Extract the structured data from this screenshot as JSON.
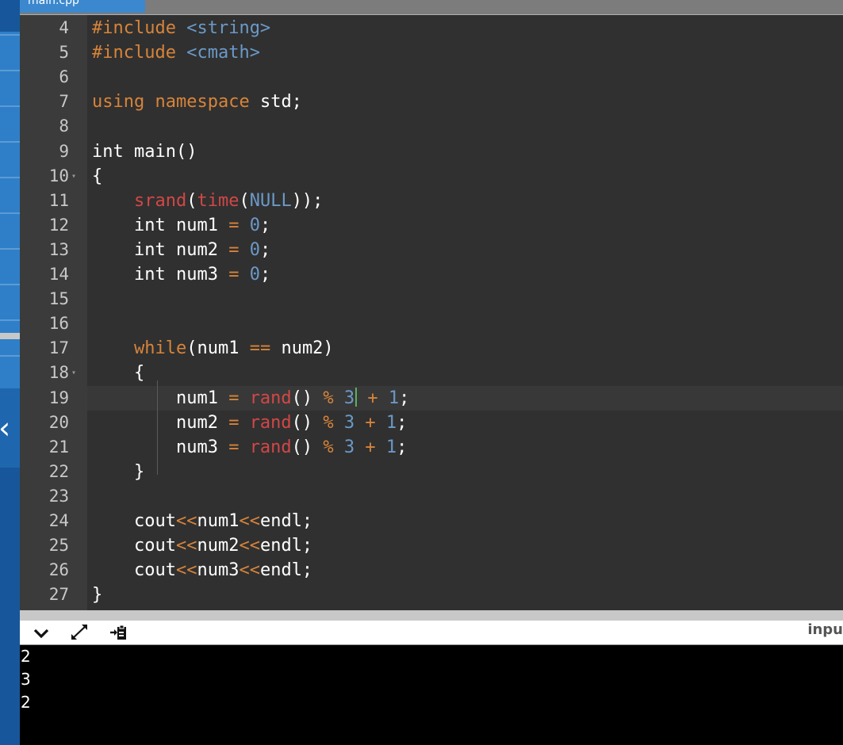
{
  "file_tab": {
    "label": "main.cpp"
  },
  "code_lines": [
    {
      "n": "4",
      "tokens": [
        [
          "kw",
          "#include"
        ],
        [
          "txt",
          " "
        ],
        [
          "str",
          "<string>"
        ]
      ]
    },
    {
      "n": "5",
      "tokens": [
        [
          "kw",
          "#include"
        ],
        [
          "txt",
          " "
        ],
        [
          "str",
          "<cmath>"
        ]
      ]
    },
    {
      "n": "6",
      "tokens": []
    },
    {
      "n": "7",
      "tokens": [
        [
          "kw",
          "using"
        ],
        [
          "txt",
          " "
        ],
        [
          "kw",
          "namespace"
        ],
        [
          "txt",
          " std;"
        ]
      ]
    },
    {
      "n": "8",
      "tokens": []
    },
    {
      "n": "9",
      "tokens": [
        [
          "txt",
          "int main()"
        ]
      ]
    },
    {
      "n": "10",
      "tokens": [
        [
          "txt",
          "{"
        ]
      ]
    },
    {
      "n": "11",
      "tokens": [
        [
          "txt",
          "    "
        ],
        [
          "fn",
          "srand"
        ],
        [
          "txt",
          "("
        ],
        [
          "fn",
          "time"
        ],
        [
          "txt",
          "("
        ],
        [
          "str",
          "NULL"
        ],
        [
          "txt",
          "));"
        ]
      ]
    },
    {
      "n": "12",
      "tokens": [
        [
          "txt",
          "    int num1 "
        ],
        [
          "op",
          "="
        ],
        [
          "txt",
          " "
        ],
        [
          "num",
          "0"
        ],
        [
          "txt",
          ";"
        ]
      ]
    },
    {
      "n": "13",
      "tokens": [
        [
          "txt",
          "    int num2 "
        ],
        [
          "op",
          "="
        ],
        [
          "txt",
          " "
        ],
        [
          "num",
          "0"
        ],
        [
          "txt",
          ";"
        ]
      ]
    },
    {
      "n": "14",
      "tokens": [
        [
          "txt",
          "    int num3 "
        ],
        [
          "op",
          "="
        ],
        [
          "txt",
          " "
        ],
        [
          "num",
          "0"
        ],
        [
          "txt",
          ";"
        ]
      ]
    },
    {
      "n": "15",
      "tokens": []
    },
    {
      "n": "16",
      "tokens": []
    },
    {
      "n": "17",
      "tokens": [
        [
          "txt",
          "    "
        ],
        [
          "kw",
          "while"
        ],
        [
          "txt",
          "(num1 "
        ],
        [
          "op",
          "=="
        ],
        [
          "txt",
          " num2)"
        ]
      ]
    },
    {
      "n": "18",
      "tokens": [
        [
          "txt",
          "    {"
        ]
      ]
    },
    {
      "n": "19",
      "tokens": [
        [
          "txt",
          "        num1 "
        ],
        [
          "op",
          "="
        ],
        [
          "txt",
          " "
        ],
        [
          "fn",
          "rand"
        ],
        [
          "txt",
          "() "
        ],
        [
          "op",
          "%"
        ],
        [
          "txt",
          " "
        ],
        [
          "num",
          "3"
        ],
        [
          "cursor",
          ""
        ],
        [
          "txt",
          " "
        ],
        [
          "op",
          "+"
        ],
        [
          "txt",
          " "
        ],
        [
          "num",
          "1"
        ],
        [
          "txt",
          ";"
        ]
      ]
    },
    {
      "n": "20",
      "tokens": [
        [
          "txt",
          "        num2 "
        ],
        [
          "op",
          "="
        ],
        [
          "txt",
          " "
        ],
        [
          "fn",
          "rand"
        ],
        [
          "txt",
          "() "
        ],
        [
          "op",
          "%"
        ],
        [
          "txt",
          " "
        ],
        [
          "num",
          "3"
        ],
        [
          "txt",
          " "
        ],
        [
          "op",
          "+"
        ],
        [
          "txt",
          " "
        ],
        [
          "num",
          "1"
        ],
        [
          "txt",
          ";"
        ]
      ]
    },
    {
      "n": "21",
      "tokens": [
        [
          "txt",
          "        num3 "
        ],
        [
          "op",
          "="
        ],
        [
          "txt",
          " "
        ],
        [
          "fn",
          "rand"
        ],
        [
          "txt",
          "() "
        ],
        [
          "op",
          "%"
        ],
        [
          "txt",
          " "
        ],
        [
          "num",
          "3"
        ],
        [
          "txt",
          " "
        ],
        [
          "op",
          "+"
        ],
        [
          "txt",
          " "
        ],
        [
          "num",
          "1"
        ],
        [
          "txt",
          ";"
        ]
      ]
    },
    {
      "n": "22",
      "tokens": [
        [
          "txt",
          "    }"
        ]
      ]
    },
    {
      "n": "23",
      "tokens": []
    },
    {
      "n": "24",
      "tokens": [
        [
          "txt",
          "    cout"
        ],
        [
          "op",
          "<<"
        ],
        [
          "txt",
          "num1"
        ],
        [
          "op",
          "<<"
        ],
        [
          "txt",
          "endl;"
        ]
      ]
    },
    {
      "n": "25",
      "tokens": [
        [
          "txt",
          "    cout"
        ],
        [
          "op",
          "<<"
        ],
        [
          "txt",
          "num2"
        ],
        [
          "op",
          "<<"
        ],
        [
          "txt",
          "endl;"
        ]
      ]
    },
    {
      "n": "26",
      "tokens": [
        [
          "txt",
          "    cout"
        ],
        [
          "op",
          "<<"
        ],
        [
          "txt",
          "num3"
        ],
        [
          "op",
          "<<"
        ],
        [
          "txt",
          "endl;"
        ]
      ]
    },
    {
      "n": "27",
      "tokens": [
        [
          "txt",
          "}"
        ]
      ]
    }
  ],
  "fold_marker_lines": [
    "10",
    "18"
  ],
  "active_line": "19",
  "toolbar": {
    "collapse_icon": "chevron-down-icon",
    "expand_icon": "expand-arrows-icon",
    "paste_icon": "clipboard-paste-icon",
    "input_label": "inpu"
  },
  "console": {
    "output": [
      "2",
      "3",
      "2"
    ]
  },
  "colors": {
    "keyword": "#d7843a",
    "string": "#6b99c8",
    "function": "#d24747",
    "editor_bg": "#303030",
    "gutter_bg": "#3b3b3b",
    "sidebar": "#2f7fc8"
  }
}
